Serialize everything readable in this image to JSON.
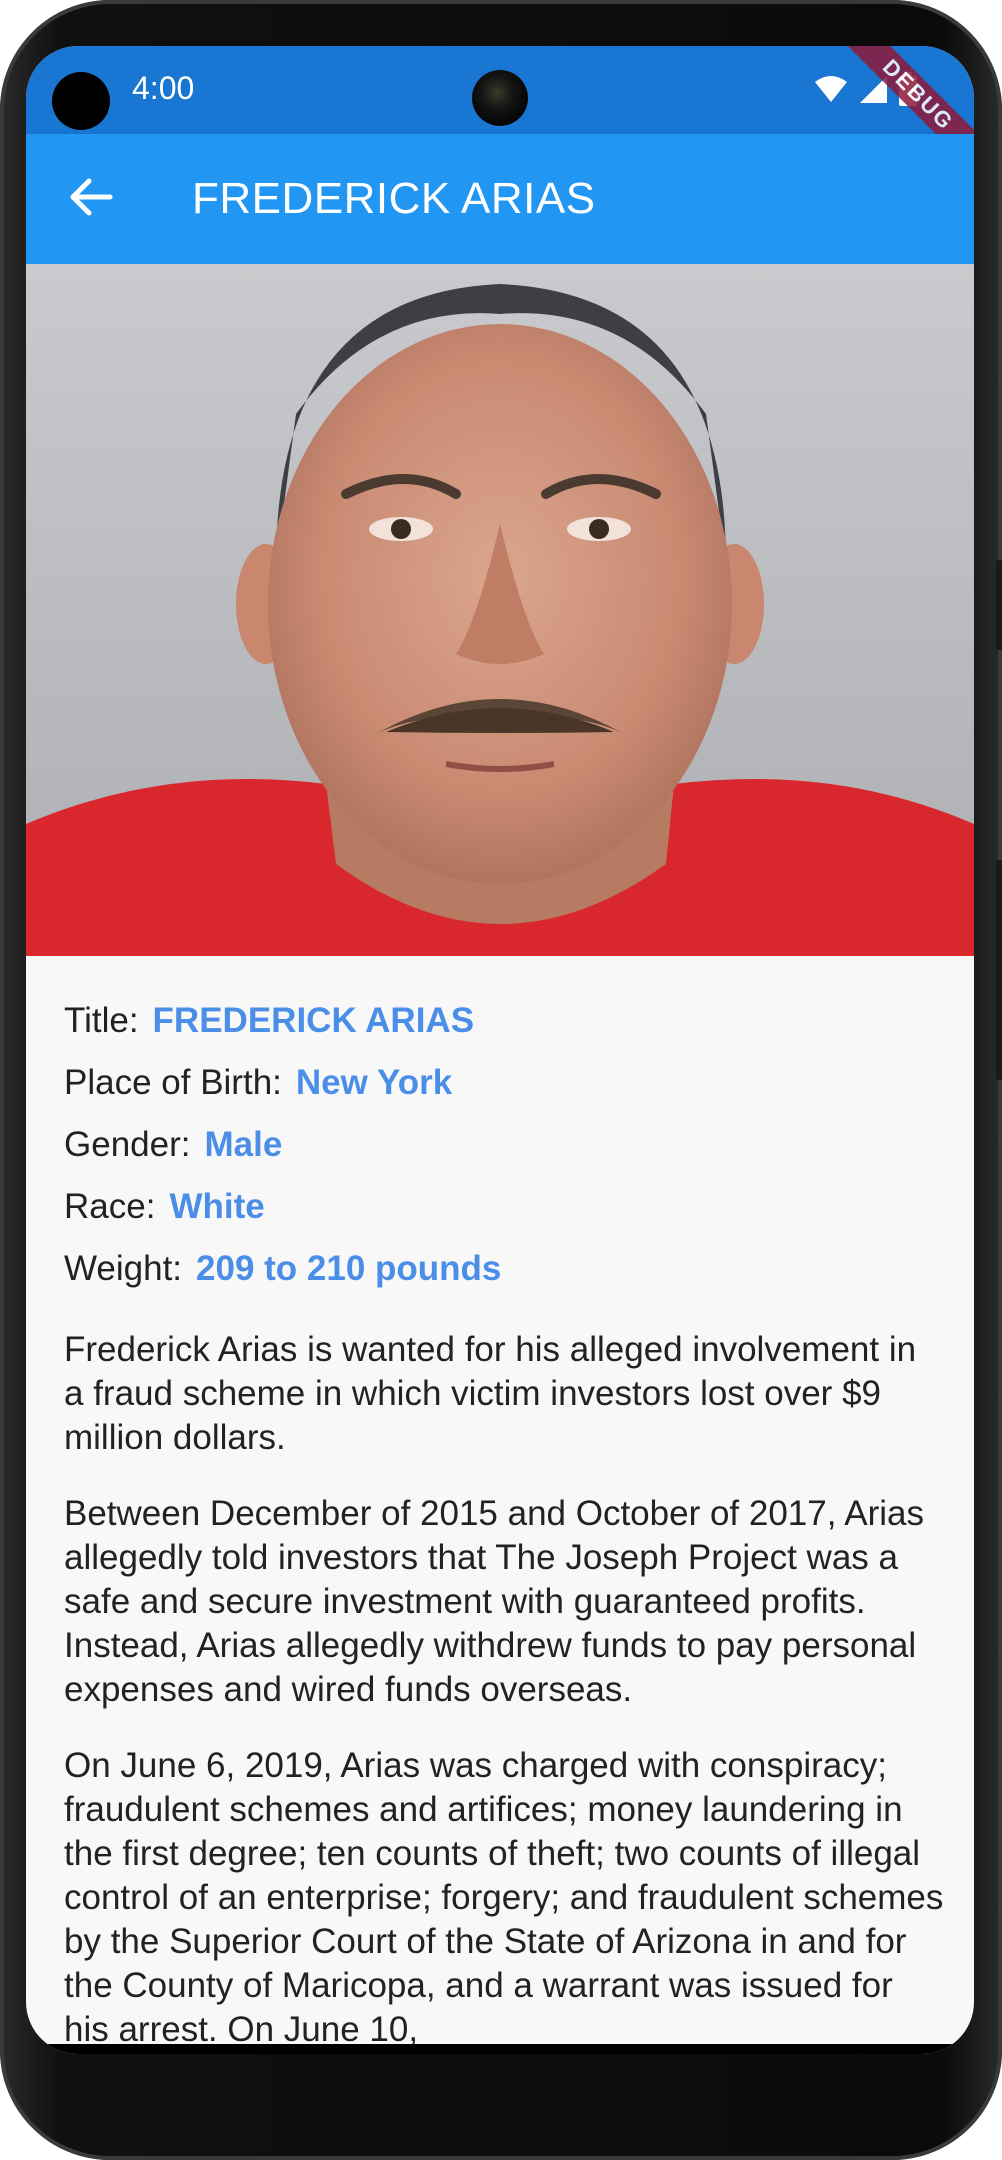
{
  "status": {
    "time": "4:00",
    "debug_label": "DEBUG",
    "icons": [
      "wifi-icon",
      "signal-icon",
      "battery-icon"
    ]
  },
  "appbar": {
    "title": "FREDERICK ARIAS",
    "back_icon": "arrow-back-icon"
  },
  "details": [
    {
      "label": "Title:",
      "value": "FREDERICK ARIAS"
    },
    {
      "label": "Place of Birth:",
      "value": "New York"
    },
    {
      "label": "Gender:",
      "value": "Male"
    },
    {
      "label": "Race:",
      "value": "White"
    },
    {
      "label": "Weight:",
      "value": "209 to 210 pounds"
    }
  ],
  "description": [
    "Frederick Arias is wanted for his alleged involvement in a fraud scheme in which victim investors lost over $9 million dollars.",
    "Between December of 2015 and October of 2017, Arias allegedly told investors that The Joseph Project was a safe and secure investment with guaranteed profits. Instead, Arias allegedly withdrew funds to pay personal expenses and wired funds overseas.",
    "On June 6, 2019, Arias was charged with conspiracy; fraudulent schemes and artifices; money laundering in the first degree; ten counts of theft; two counts of illegal control of an enterprise; forgery; and fraudulent schemes by the Superior Court of the State of Arizona in and for the County of Maricopa, and a warrant was issued for his arrest. On June 10,"
  ],
  "colors": {
    "statusbar": "#1976d2",
    "appbar": "#2196f3",
    "accent_value": "#4a8ee8",
    "background": "#f8f8f8"
  }
}
